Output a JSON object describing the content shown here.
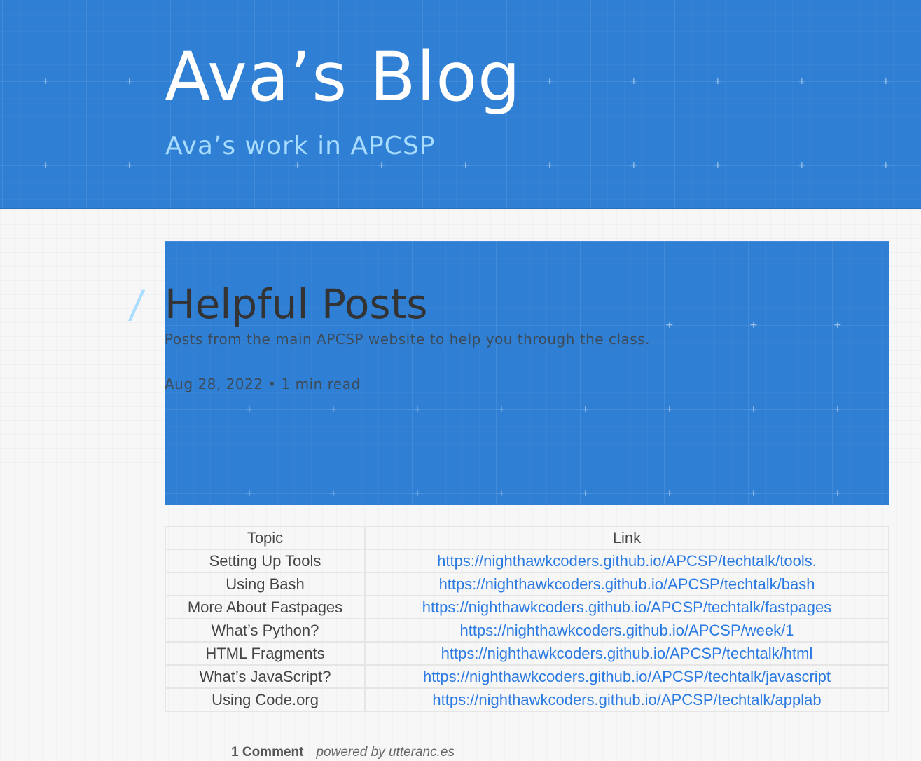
{
  "header": {
    "title": "Ava’s Blog",
    "subtitle": "Ava’s work in APCSP"
  },
  "post": {
    "anchor": "/",
    "title": "Helpful Posts",
    "description": "Posts from the main APCSP website to help you through the class.",
    "meta": "Aug 28, 2022 • 1 min read"
  },
  "table": {
    "headers": [
      "Topic",
      "Link"
    ],
    "rows": [
      {
        "topic": "Setting Up Tools",
        "link": "https://nighthawkcoders.github.io/APCSP/techtalk/tools."
      },
      {
        "topic": "Using Bash",
        "link": "https://nighthawkcoders.github.io/APCSP/techtalk/bash"
      },
      {
        "topic": "More About Fastpages",
        "link": "https://nighthawkcoders.github.io/APCSP/techtalk/fastpages"
      },
      {
        "topic": "What’s Python?",
        "link": "https://nighthawkcoders.github.io/APCSP/week/1"
      },
      {
        "topic": "HTML Fragments",
        "link": "https://nighthawkcoders.github.io/APCSP/techtalk/html"
      },
      {
        "topic": "What’s JavaScript?",
        "link": "https://nighthawkcoders.github.io/APCSP/techtalk/javascript"
      },
      {
        "topic": "Using Code.org",
        "link": "https://nighthawkcoders.github.io/APCSP/techtalk/applab"
      }
    ]
  },
  "comments": {
    "count_label": "1 Comment",
    "powered_by": "powered by utteranc.es"
  },
  "colors": {
    "header_background": "#2f7fd4",
    "subtitle": "#a9ddff",
    "link": "#2a7ae2",
    "page_background": "#f7f7f7"
  }
}
